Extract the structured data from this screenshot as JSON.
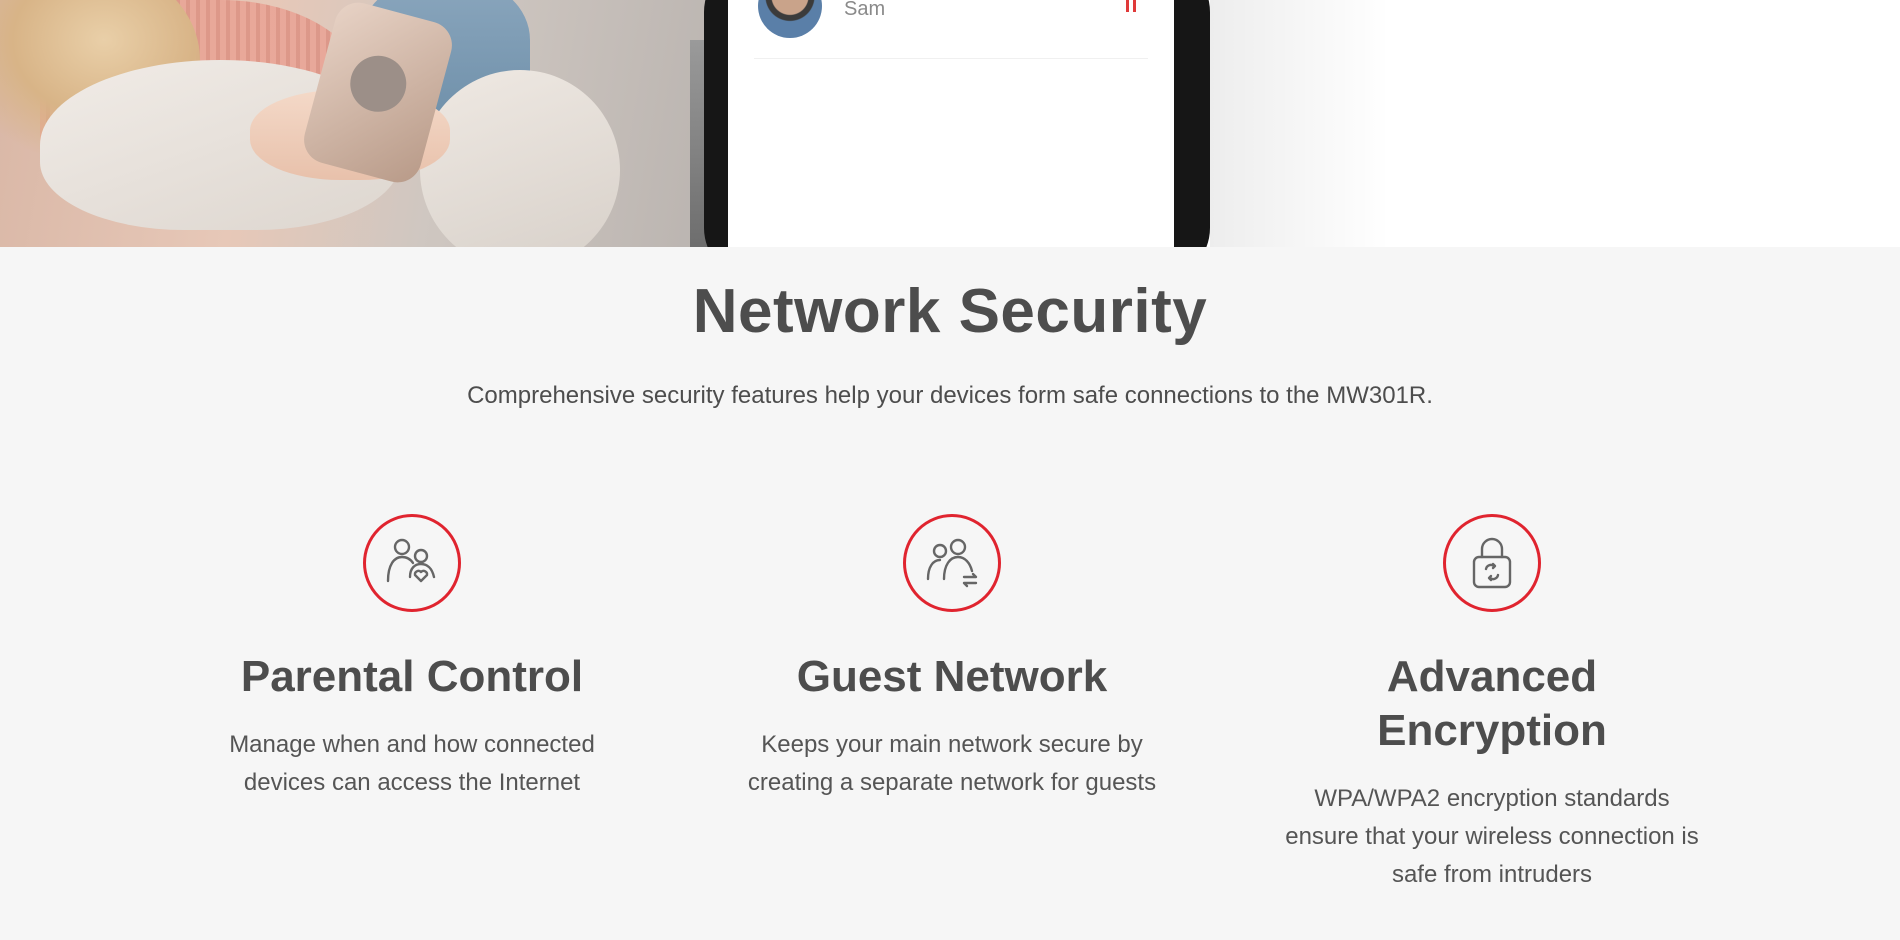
{
  "hero": {
    "contact_name": "Sam"
  },
  "section": {
    "title": "Network Security",
    "subtitle": "Comprehensive security features help your devices form safe connections to the MW301R."
  },
  "features": [
    {
      "icon": "parental-control-icon",
      "title": "Parental Control",
      "description": "Manage when and how connected devices can access the Internet"
    },
    {
      "icon": "guest-network-icon",
      "title": "Guest Network",
      "description": "Keeps your main network secure by creating a separate network for guests"
    },
    {
      "icon": "encryption-lock-icon",
      "title": "Advanced Encryption",
      "description": "WPA/WPA2 encryption standards ensure that your wireless connection is safe from intruders"
    }
  ],
  "colors": {
    "accent": "#e0242f",
    "text": "#4d4d4d",
    "background": "#f6f6f6"
  }
}
